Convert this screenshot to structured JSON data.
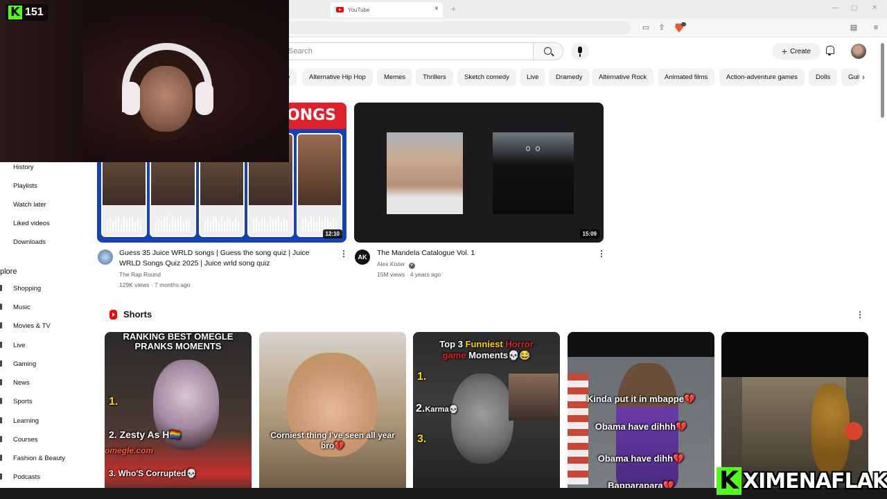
{
  "browser": {
    "tab_title": "YouTube",
    "tab_close": "×",
    "new_tab": "+"
  },
  "header": {
    "search_placeholder": "Search",
    "create_label": "Create",
    "create_plus": "+"
  },
  "chips": [
    "e",
    "Alternative Hip Hop",
    "Memes",
    "Thrillers",
    "Sketch comedy",
    "Live",
    "Dramedy",
    "Alternative Rock",
    "Animated films",
    "Action-adventure games",
    "Dolls",
    "Guit"
  ],
  "chip_next": "›",
  "sidebar": {
    "you_items": [
      "History",
      "Playlists",
      "Watch later",
      "Liked videos",
      "Downloads"
    ],
    "explore_heading": "plore",
    "explore_items": [
      "Shopping",
      "Music",
      "Movies & TV",
      "Live",
      "Gaming",
      "News",
      "Sports",
      "Learning",
      "Courses",
      "Fashion & Beauty",
      "Podcasts"
    ]
  },
  "videos": [
    {
      "banner": "ONGS",
      "title_line1": "Guess 35 Juice WRLD songs | Guess the song quiz | Juice",
      "title_line2": "WRLD Songs Quiz 2025 | Juice wrld song quiz",
      "channel": "The Rap Round",
      "meta": "129K views · 7 months ago",
      "duration": "12:10"
    },
    {
      "title_line1": "The Mandela Catalogue Vol. 1",
      "channel": "Alex Kister",
      "verified": "✔",
      "channel_avatar_text": "AK",
      "meta": "15M views · 4 years ago",
      "duration": "15:09"
    }
  ],
  "kebab": "⋮",
  "shorts": {
    "heading": "Shorts",
    "items": [
      {
        "top_text": "RANKING BEST OMEGLE PRANKS MOMENTS",
        "n1": "1.",
        "l2": "2. Zesty As H🏳️‍🌈",
        "brand": "omegle.com",
        "l3": "3. Who'S Corrupted💀"
      },
      {
        "caption": "Corniest thing I've seen all year bro💔"
      },
      {
        "title_a": "Top 3 ",
        "title_b": "Funniest ",
        "title_c": "Horror",
        "title_d": "game",
        "title_e": " Moments💀😂",
        "n1": "1.",
        "n2": "2.",
        "karma": "Karma💀",
        "n3": "3."
      },
      {
        "l1": "Kinda put it in mbappe💔",
        "l2": "Obama have dihhh💔",
        "l3": "Obama have dihh💔",
        "l4": "Bapparapara💔"
      },
      {}
    ]
  },
  "overlay": {
    "kick_letter": "K",
    "viewer_count": "151",
    "streamer_name": "XIMENAFLAKA"
  },
  "colors": {
    "accent": "#ff0000",
    "kick_green": "#53fc18",
    "chip_bg": "#f2f2f2",
    "meta_text": "#606060"
  }
}
